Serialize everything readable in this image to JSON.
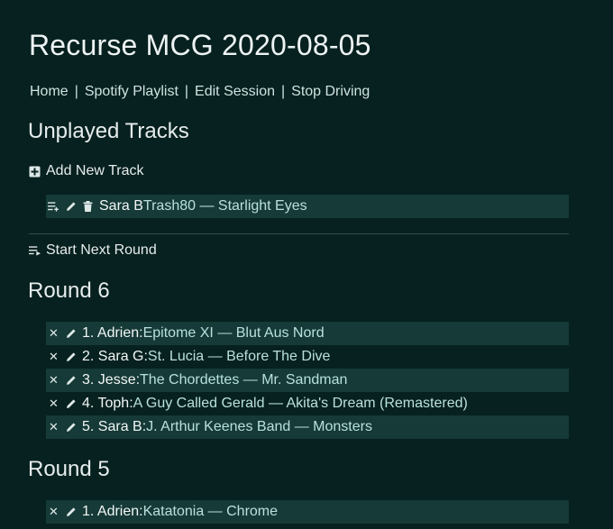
{
  "page_title": "Recurse MCG 2020-08-05",
  "nav": {
    "items": [
      "Home",
      "Spotify Playlist",
      "Edit Session",
      "Stop Driving"
    ],
    "separator": "|"
  },
  "unplayed": {
    "heading": "Unplayed Tracks",
    "add_label": "Add New Track",
    "tracks": [
      {
        "who": "Sara B ",
        "song": "Trash80 — Starlight Eyes"
      }
    ],
    "start_round_label": "Start Next Round"
  },
  "rounds": [
    {
      "heading": "Round 6",
      "tracks": [
        {
          "who": "1. Adrien: ",
          "song": "Epitome XI — Blut Aus Nord"
        },
        {
          "who": "2. Sara G: ",
          "song": "St. Lucia — Before The Dive"
        },
        {
          "who": "3. Jesse: ",
          "song": "The Chordettes — Mr. Sandman"
        },
        {
          "who": "4. Toph: ",
          "song": "A Guy Called Gerald — Akita's Dream (Remastered)"
        },
        {
          "who": "5. Sara B: ",
          "song": "J. Arthur Keenes Band — Monsters"
        }
      ]
    },
    {
      "heading": "Round 5",
      "tracks": [
        {
          "who": "1. Adrien: ",
          "song": "Katatonia — Chrome"
        }
      ]
    }
  ],
  "icons": {
    "add": "plus-square-icon",
    "queue": "playlist-add-icon",
    "edit": "pencil-icon",
    "delete": "trash-icon",
    "remove": "close-icon",
    "next_round": "playlist-play-icon"
  },
  "colors": {
    "background": "#06211f",
    "row_shade": "#153a37",
    "song_text": "#b9e0dd"
  }
}
